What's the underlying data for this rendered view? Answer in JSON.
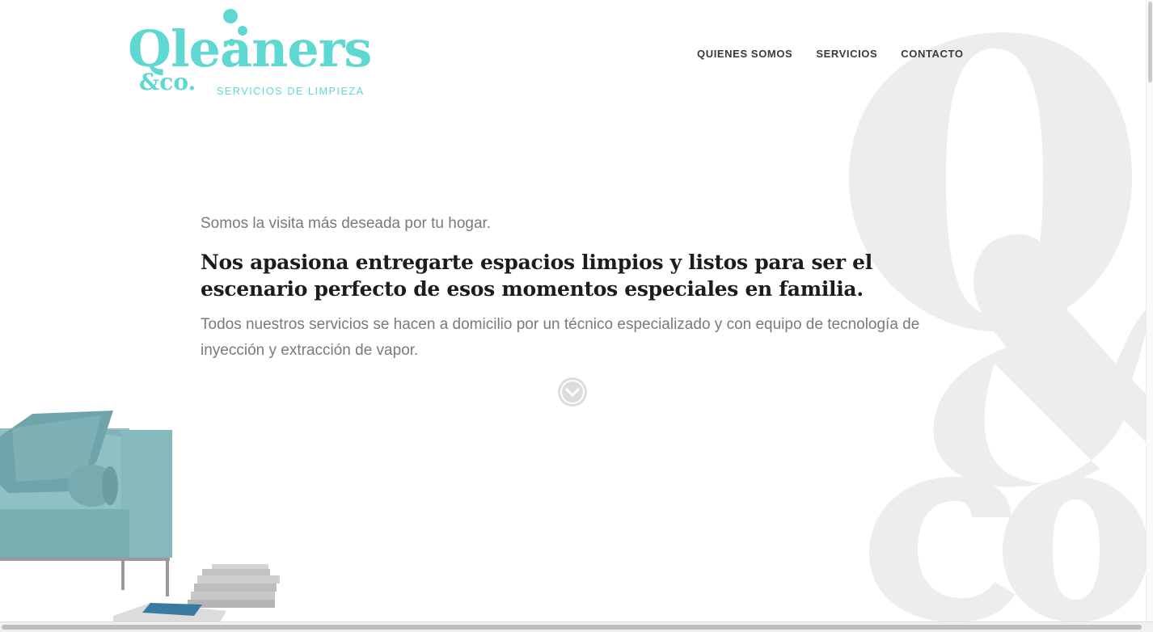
{
  "brand": {
    "name": "Qleaners",
    "suffix": "&co.",
    "tagline": "SERVICIOS DE LIMPIEZA",
    "accent_color": "#5fd8d2"
  },
  "nav": {
    "items": [
      {
        "label": "QUIENES SOMOS"
      },
      {
        "label": "SERVICIOS"
      },
      {
        "label": "CONTACTO"
      }
    ]
  },
  "hero": {
    "kicker": "Somos la visita más deseada por tu hogar.",
    "headline": "Nos apasiona entregarte espacios limpios y listos para ser el escenario perfecto de esos momentos especiales en familia.",
    "body": "Todos nuestros servicios se hacen a domicilio por un técnico especializado y con equipo de tecnología de inyección y extracción de vapor.",
    "scroll_icon": "chevron-down-icon"
  },
  "decor": {
    "watermark": "Q&co.",
    "sofa_color": "#7fb3b8"
  }
}
